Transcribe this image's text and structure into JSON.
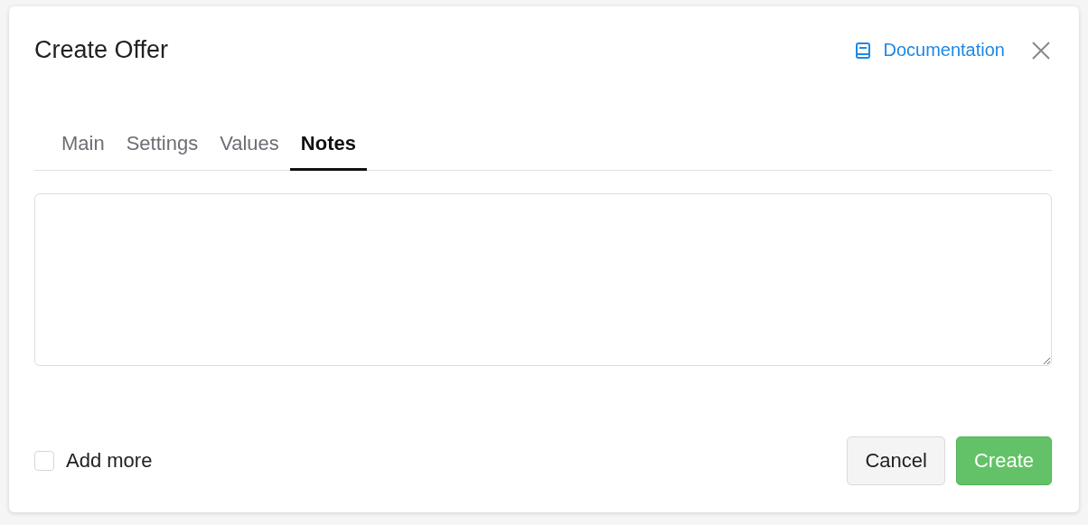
{
  "dialog": {
    "title": "Create Offer",
    "documentation_link": "Documentation"
  },
  "tabs": [
    {
      "label": "Main",
      "selected": false
    },
    {
      "label": "Settings",
      "selected": false
    },
    {
      "label": "Values",
      "selected": false
    },
    {
      "label": "Notes",
      "selected": true
    }
  ],
  "footer": {
    "add_more": {
      "label": "Add more",
      "checked": false
    },
    "buttons": [
      {
        "label": "Cancel",
        "kind": "secondary"
      },
      {
        "label": "Create",
        "kind": "primary"
      }
    ]
  }
}
